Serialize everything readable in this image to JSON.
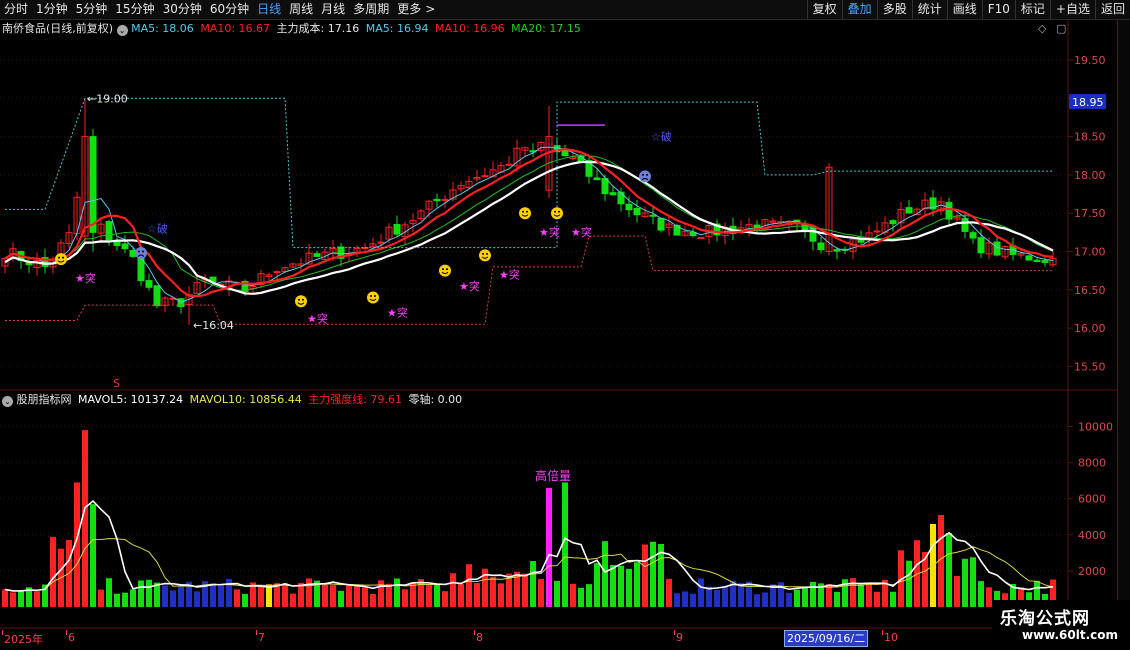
{
  "toolbar": {
    "periods": [
      "分时",
      "1分钟",
      "5分钟",
      "15分钟",
      "30分钟",
      "60分钟",
      "日线",
      "周线",
      "月线",
      "多周期",
      "更多"
    ],
    "active_period": "日线",
    "more_arrow": ">",
    "right_buttons": [
      "复权",
      "叠加",
      "多股",
      "统计",
      "画线",
      "F10",
      "标记",
      "+自选",
      "返回"
    ],
    "active_right": "叠加"
  },
  "price_panel": {
    "stock_name": "南侨食品(日线,前复权)",
    "ma5_label": "MA5: 18.06",
    "ma10_label": "MA10: 16.67",
    "cost_label": "主力成本: 17.16",
    "cost_ma5_label": "MA5: 16.94",
    "cost_ma10_label": "MA10: 16.96",
    "cost_ma20_label": "MA20: 17.15",
    "y_ticks": [
      "19.50",
      "19.00",
      "18.50",
      "18.00",
      "17.50",
      "17.00",
      "16.50",
      "16.00",
      "15.50"
    ],
    "current_price": "18.95",
    "high_marker": "19.00",
    "low_marker": "16:04",
    "tag_tu": "★突",
    "tag_po": "☆破"
  },
  "volume_panel": {
    "indicator_name": "股朋指标网",
    "mavol5_label": "MAVOL5: 10137.24",
    "mavol10_label": "MAVOL10: 10856.44",
    "strength_label": "主力强度线: 79.61",
    "zero_label": "零轴: 0.00",
    "y_ticks": [
      "10000",
      "8000",
      "6000",
      "4000",
      "2000"
    ],
    "spike_label": "高倍量",
    "s_marker": "S"
  },
  "date_axis": {
    "labels": [
      "2025年",
      "6",
      "7",
      "8",
      "9",
      "10"
    ],
    "cursor_date": "2025/09/16/二"
  },
  "watermark": {
    "title": "乐淘公式网",
    "url": "www.60lt.com"
  },
  "colors": {
    "up": "#ff2020",
    "down": "#10e010",
    "ma_white": "#ffffff",
    "ma_red": "#ff2020",
    "ma_green": "#20c020",
    "ma_cyan": "#5ac8e8",
    "grid": "#5a1414",
    "highlight_link": "#4aa3ff"
  }
}
